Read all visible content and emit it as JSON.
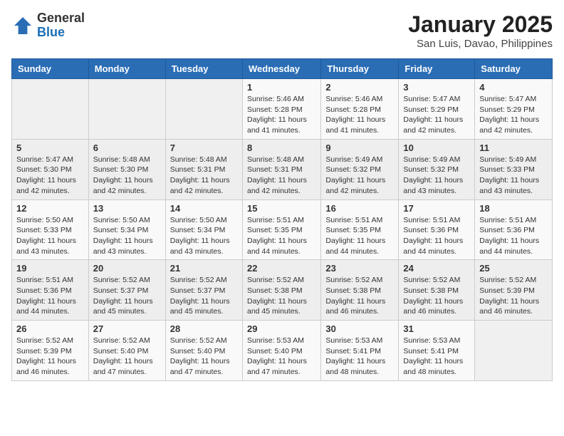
{
  "header": {
    "logo_general": "General",
    "logo_blue": "Blue",
    "title": "January 2025",
    "subtitle": "San Luis, Davao, Philippines"
  },
  "calendar": {
    "days_of_week": [
      "Sunday",
      "Monday",
      "Tuesday",
      "Wednesday",
      "Thursday",
      "Friday",
      "Saturday"
    ],
    "weeks": [
      [
        {
          "day": "",
          "sunrise": "",
          "sunset": "",
          "daylight": ""
        },
        {
          "day": "",
          "sunrise": "",
          "sunset": "",
          "daylight": ""
        },
        {
          "day": "",
          "sunrise": "",
          "sunset": "",
          "daylight": ""
        },
        {
          "day": "1",
          "sunrise": "Sunrise: 5:46 AM",
          "sunset": "Sunset: 5:28 PM",
          "daylight": "Daylight: 11 hours and 41 minutes."
        },
        {
          "day": "2",
          "sunrise": "Sunrise: 5:46 AM",
          "sunset": "Sunset: 5:28 PM",
          "daylight": "Daylight: 11 hours and 41 minutes."
        },
        {
          "day": "3",
          "sunrise": "Sunrise: 5:47 AM",
          "sunset": "Sunset: 5:29 PM",
          "daylight": "Daylight: 11 hours and 42 minutes."
        },
        {
          "day": "4",
          "sunrise": "Sunrise: 5:47 AM",
          "sunset": "Sunset: 5:29 PM",
          "daylight": "Daylight: 11 hours and 42 minutes."
        }
      ],
      [
        {
          "day": "5",
          "sunrise": "Sunrise: 5:47 AM",
          "sunset": "Sunset: 5:30 PM",
          "daylight": "Daylight: 11 hours and 42 minutes."
        },
        {
          "day": "6",
          "sunrise": "Sunrise: 5:48 AM",
          "sunset": "Sunset: 5:30 PM",
          "daylight": "Daylight: 11 hours and 42 minutes."
        },
        {
          "day": "7",
          "sunrise": "Sunrise: 5:48 AM",
          "sunset": "Sunset: 5:31 PM",
          "daylight": "Daylight: 11 hours and 42 minutes."
        },
        {
          "day": "8",
          "sunrise": "Sunrise: 5:48 AM",
          "sunset": "Sunset: 5:31 PM",
          "daylight": "Daylight: 11 hours and 42 minutes."
        },
        {
          "day": "9",
          "sunrise": "Sunrise: 5:49 AM",
          "sunset": "Sunset: 5:32 PM",
          "daylight": "Daylight: 11 hours and 42 minutes."
        },
        {
          "day": "10",
          "sunrise": "Sunrise: 5:49 AM",
          "sunset": "Sunset: 5:32 PM",
          "daylight": "Daylight: 11 hours and 43 minutes."
        },
        {
          "day": "11",
          "sunrise": "Sunrise: 5:49 AM",
          "sunset": "Sunset: 5:33 PM",
          "daylight": "Daylight: 11 hours and 43 minutes."
        }
      ],
      [
        {
          "day": "12",
          "sunrise": "Sunrise: 5:50 AM",
          "sunset": "Sunset: 5:33 PM",
          "daylight": "Daylight: 11 hours and 43 minutes."
        },
        {
          "day": "13",
          "sunrise": "Sunrise: 5:50 AM",
          "sunset": "Sunset: 5:34 PM",
          "daylight": "Daylight: 11 hours and 43 minutes."
        },
        {
          "day": "14",
          "sunrise": "Sunrise: 5:50 AM",
          "sunset": "Sunset: 5:34 PM",
          "daylight": "Daylight: 11 hours and 43 minutes."
        },
        {
          "day": "15",
          "sunrise": "Sunrise: 5:51 AM",
          "sunset": "Sunset: 5:35 PM",
          "daylight": "Daylight: 11 hours and 44 minutes."
        },
        {
          "day": "16",
          "sunrise": "Sunrise: 5:51 AM",
          "sunset": "Sunset: 5:35 PM",
          "daylight": "Daylight: 11 hours and 44 minutes."
        },
        {
          "day": "17",
          "sunrise": "Sunrise: 5:51 AM",
          "sunset": "Sunset: 5:36 PM",
          "daylight": "Daylight: 11 hours and 44 minutes."
        },
        {
          "day": "18",
          "sunrise": "Sunrise: 5:51 AM",
          "sunset": "Sunset: 5:36 PM",
          "daylight": "Daylight: 11 hours and 44 minutes."
        }
      ],
      [
        {
          "day": "19",
          "sunrise": "Sunrise: 5:51 AM",
          "sunset": "Sunset: 5:36 PM",
          "daylight": "Daylight: 11 hours and 44 minutes."
        },
        {
          "day": "20",
          "sunrise": "Sunrise: 5:52 AM",
          "sunset": "Sunset: 5:37 PM",
          "daylight": "Daylight: 11 hours and 45 minutes."
        },
        {
          "day": "21",
          "sunrise": "Sunrise: 5:52 AM",
          "sunset": "Sunset: 5:37 PM",
          "daylight": "Daylight: 11 hours and 45 minutes."
        },
        {
          "day": "22",
          "sunrise": "Sunrise: 5:52 AM",
          "sunset": "Sunset: 5:38 PM",
          "daylight": "Daylight: 11 hours and 45 minutes."
        },
        {
          "day": "23",
          "sunrise": "Sunrise: 5:52 AM",
          "sunset": "Sunset: 5:38 PM",
          "daylight": "Daylight: 11 hours and 46 minutes."
        },
        {
          "day": "24",
          "sunrise": "Sunrise: 5:52 AM",
          "sunset": "Sunset: 5:38 PM",
          "daylight": "Daylight: 11 hours and 46 minutes."
        },
        {
          "day": "25",
          "sunrise": "Sunrise: 5:52 AM",
          "sunset": "Sunset: 5:39 PM",
          "daylight": "Daylight: 11 hours and 46 minutes."
        }
      ],
      [
        {
          "day": "26",
          "sunrise": "Sunrise: 5:52 AM",
          "sunset": "Sunset: 5:39 PM",
          "daylight": "Daylight: 11 hours and 46 minutes."
        },
        {
          "day": "27",
          "sunrise": "Sunrise: 5:52 AM",
          "sunset": "Sunset: 5:40 PM",
          "daylight": "Daylight: 11 hours and 47 minutes."
        },
        {
          "day": "28",
          "sunrise": "Sunrise: 5:52 AM",
          "sunset": "Sunset: 5:40 PM",
          "daylight": "Daylight: 11 hours and 47 minutes."
        },
        {
          "day": "29",
          "sunrise": "Sunrise: 5:53 AM",
          "sunset": "Sunset: 5:40 PM",
          "daylight": "Daylight: 11 hours and 47 minutes."
        },
        {
          "day": "30",
          "sunrise": "Sunrise: 5:53 AM",
          "sunset": "Sunset: 5:41 PM",
          "daylight": "Daylight: 11 hours and 48 minutes."
        },
        {
          "day": "31",
          "sunrise": "Sunrise: 5:53 AM",
          "sunset": "Sunset: 5:41 PM",
          "daylight": "Daylight: 11 hours and 48 minutes."
        },
        {
          "day": "",
          "sunrise": "",
          "sunset": "",
          "daylight": ""
        }
      ]
    ]
  }
}
